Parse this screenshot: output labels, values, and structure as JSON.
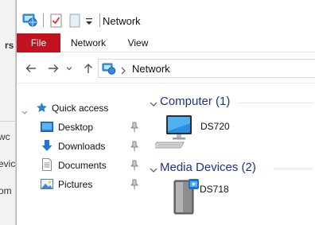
{
  "window": {
    "title": "Network"
  },
  "ribbon": {
    "tabs": [
      "File",
      "Network",
      "View"
    ]
  },
  "address": {
    "path": "Network"
  },
  "navigation": {
    "quick_access_label": "Quick access",
    "items": [
      {
        "label": "Desktop",
        "icon": "desktop-icon",
        "pinned": true
      },
      {
        "label": "Downloads",
        "icon": "downloads-icon",
        "pinned": true
      },
      {
        "label": "Documents",
        "icon": "documents-icon",
        "pinned": true
      },
      {
        "label": "Pictures",
        "icon": "pictures-icon",
        "pinned": true
      }
    ]
  },
  "groups": [
    {
      "title": "Computer (1)",
      "items": [
        {
          "label": "DS720",
          "icon": "computer-icon"
        }
      ]
    },
    {
      "title": "Media Devices (2)",
      "items": [
        {
          "label": "DS718",
          "icon": "media-server-icon"
        }
      ]
    }
  ],
  "background_window": {
    "fragments": [
      "rs",
      "wc",
      "evic",
      "om"
    ]
  },
  "colors": {
    "file_tab": "#c1131f",
    "group_header": "#1e3287",
    "accent": "#0078d7"
  }
}
